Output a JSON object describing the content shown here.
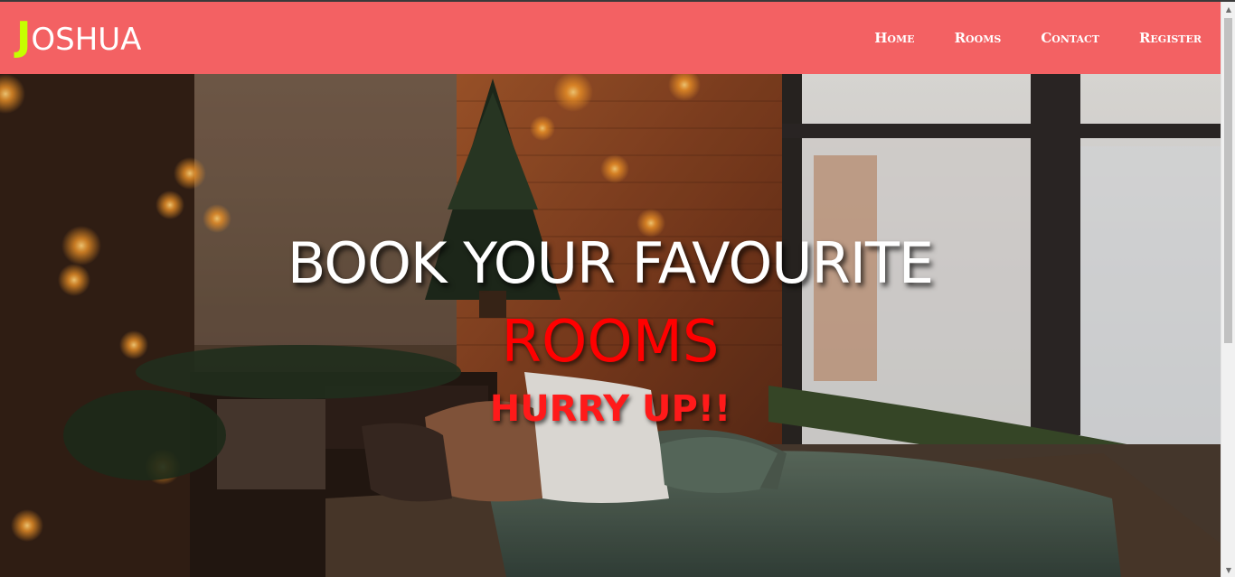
{
  "brand": {
    "first_letter": "J",
    "rest": "OSHUA",
    "accent_color": "#c6ff00"
  },
  "navbar": {
    "background": "#f36163",
    "links": [
      {
        "label": "Home"
      },
      {
        "label": "Rooms"
      },
      {
        "label": "Contact"
      },
      {
        "label": "Register"
      }
    ]
  },
  "hero": {
    "headline": "BOOK YOUR FAVOURITE",
    "accent": "ROOMS",
    "urgency": "HURRY UP!!",
    "headline_color": "#ffffff",
    "accent_color": "#ff0000"
  },
  "scrollbar": {
    "up_icon": "scroll-up-arrow-icon",
    "down_icon": "scroll-down-arrow-icon"
  }
}
